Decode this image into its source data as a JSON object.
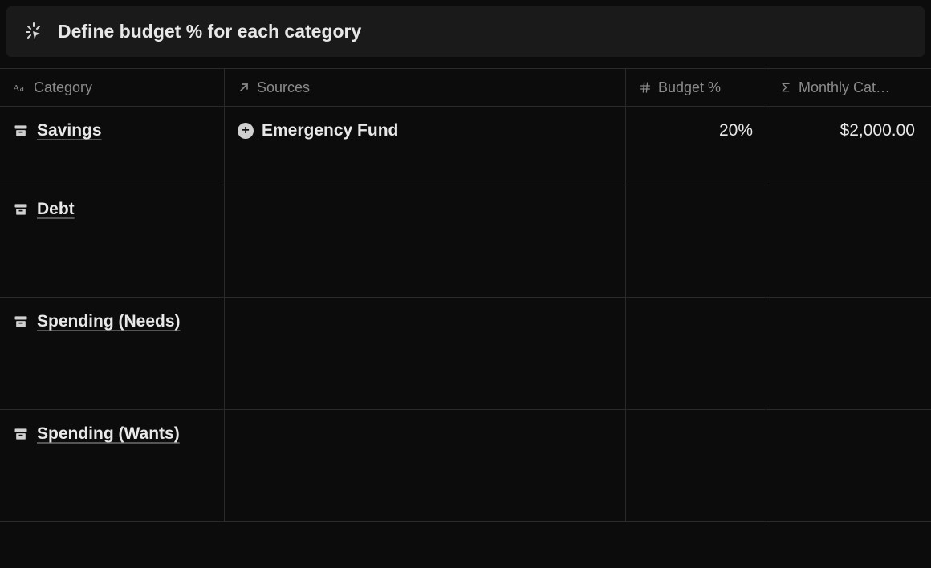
{
  "callout": {
    "title": "Define budget % for each category"
  },
  "columns": {
    "category": "Category",
    "sources": "Sources",
    "budget": "Budget %",
    "monthly": "Monthly Cat…"
  },
  "rows": [
    {
      "category": "Savings",
      "source": "Emergency Fund",
      "budget": "20%",
      "monthly": "$2,000.00"
    },
    {
      "category": "Debt",
      "source": "",
      "budget": "",
      "monthly": ""
    },
    {
      "category": "Spending (Needs)",
      "source": "",
      "budget": "",
      "monthly": ""
    },
    {
      "category": "Spending (Wants)",
      "source": "",
      "budget": "",
      "monthly": ""
    }
  ]
}
